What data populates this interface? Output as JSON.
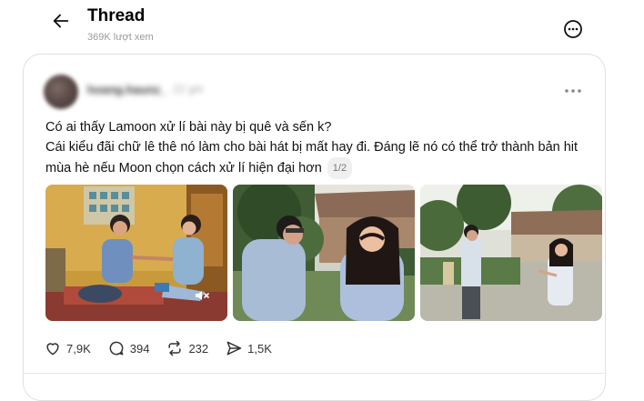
{
  "header": {
    "title": "Thread",
    "views": "369K lượt xem"
  },
  "post": {
    "username_blurred": "hoang.haunz_",
    "time_blurred": "22 giờ",
    "line1": "Có ai thấy Lamoon xử lí bài này bị quê và sến k?",
    "line2": "Cái kiểu đãi chữ lê thê nó làm cho bài hát bị mất hay đi. Đáng lẽ nó có thể trở thành bản hit mùa hè nếu Moon chọn cách xử lí hiện đại hơn",
    "page_indicator": "1/2",
    "media": [
      "video-couple-indoor",
      "photo-couple-garden",
      "photo-couple-courtyard"
    ]
  },
  "actions": {
    "likes": "7,9K",
    "comments": "394",
    "reposts": "232",
    "shares": "1,5K"
  },
  "icons": {
    "back": "arrow-left-icon",
    "menu": "more-circle-icon",
    "post_menu": "more-dots-icon",
    "like": "heart-icon",
    "comment": "comment-icon",
    "repost": "repost-icon",
    "share": "send-icon",
    "mute": "speaker-muted-icon"
  }
}
